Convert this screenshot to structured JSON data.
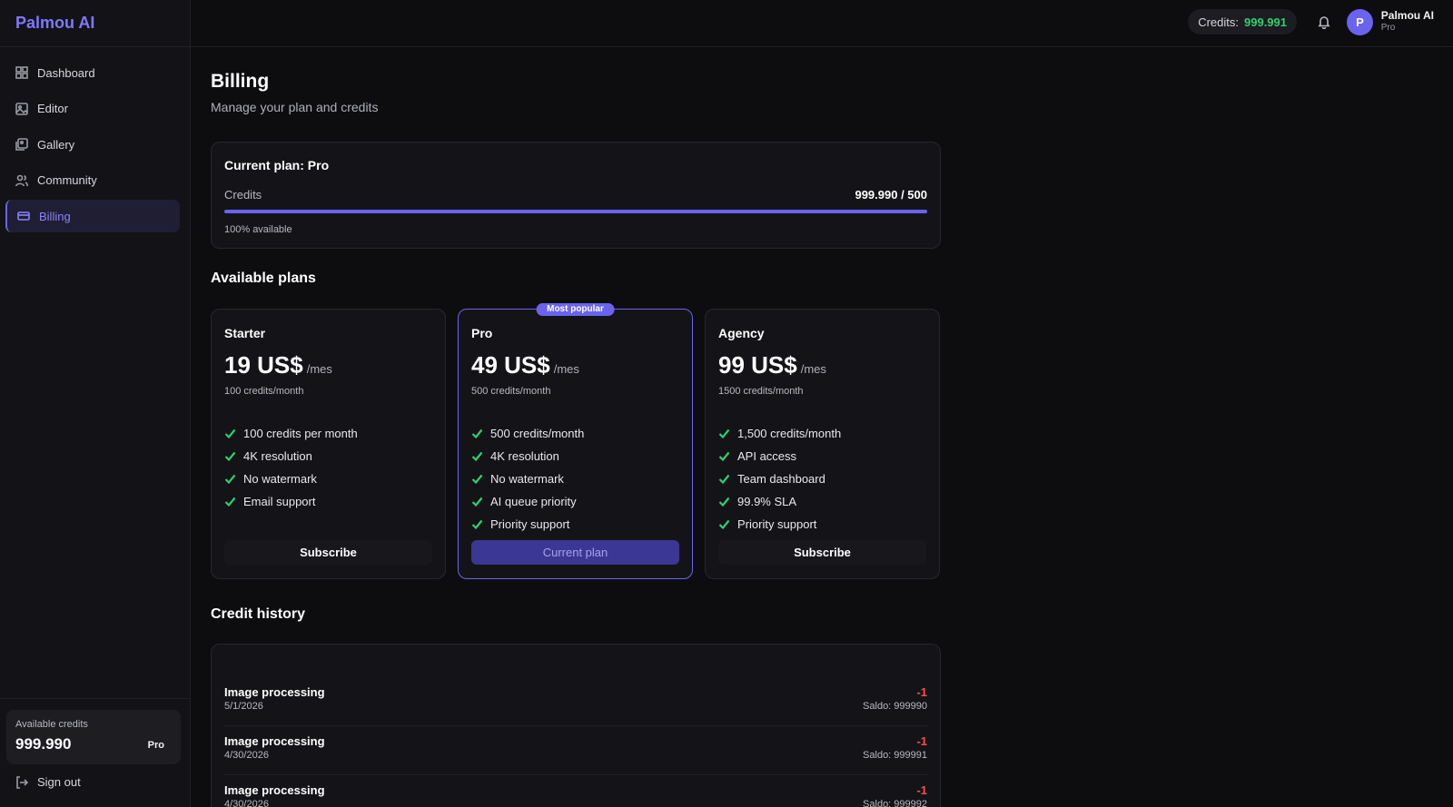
{
  "brand": "Palmou AI",
  "sidebar": {
    "items": [
      {
        "label": "Dashboard",
        "icon": "grid-icon"
      },
      {
        "label": "Editor",
        "icon": "image-icon"
      },
      {
        "label": "Gallery",
        "icon": "images-icon"
      },
      {
        "label": "Community",
        "icon": "users-icon"
      },
      {
        "label": "Billing",
        "icon": "card-icon",
        "active": true
      }
    ],
    "credits_label": "Available credits",
    "credits_value": "999.990",
    "tier": "Pro",
    "signout": "Sign out"
  },
  "topbar": {
    "credits_label": "Credits:",
    "credits_value": "999.991",
    "avatar_letter": "P",
    "user_name": "Palmou AI",
    "user_plan": "Pro"
  },
  "page": {
    "title": "Billing",
    "subtitle": "Manage your plan and credits"
  },
  "current_plan": {
    "title": "Current plan: Pro",
    "credits_label": "Credits",
    "credits_value": "999.990 / 500",
    "available": "100% available",
    "fill_percent": 100
  },
  "plans_title": "Available plans",
  "plans": [
    {
      "name": "Starter",
      "price": "19 US$",
      "period": "/mes",
      "credits": "100 credits/month",
      "features": [
        "100 credits per month",
        "4K resolution",
        "No watermark",
        "Email support"
      ],
      "button": "Subscribe"
    },
    {
      "name": "Pro",
      "badge": "Most popular",
      "price": "49 US$",
      "period": "/mes",
      "credits": "500 credits/month",
      "features": [
        "500 credits/month",
        "4K resolution",
        "No watermark",
        "AI queue priority",
        "Priority support"
      ],
      "button": "Current plan"
    },
    {
      "name": "Agency",
      "price": "99 US$",
      "period": "/mes",
      "credits": "1500 credits/month",
      "features": [
        "1,500 credits/month",
        "API access",
        "Team dashboard",
        "99.9% SLA",
        "Priority support"
      ],
      "button": "Subscribe"
    }
  ],
  "history_title": "Credit history",
  "history": [
    {
      "title": "Image processing",
      "date": "5/1/2026",
      "amount": "-1",
      "balance": "Saldo: 999990"
    },
    {
      "title": "Image processing",
      "date": "4/30/2026",
      "amount": "-1",
      "balance": "Saldo: 999991"
    },
    {
      "title": "Image processing",
      "date": "4/30/2026",
      "amount": "-1",
      "balance": "Saldo: 999992"
    }
  ],
  "colors": {
    "accent": "#6a63f0",
    "positive": "#2fd06e",
    "negative": "#ff4d4d",
    "background": "#0d0d10"
  }
}
